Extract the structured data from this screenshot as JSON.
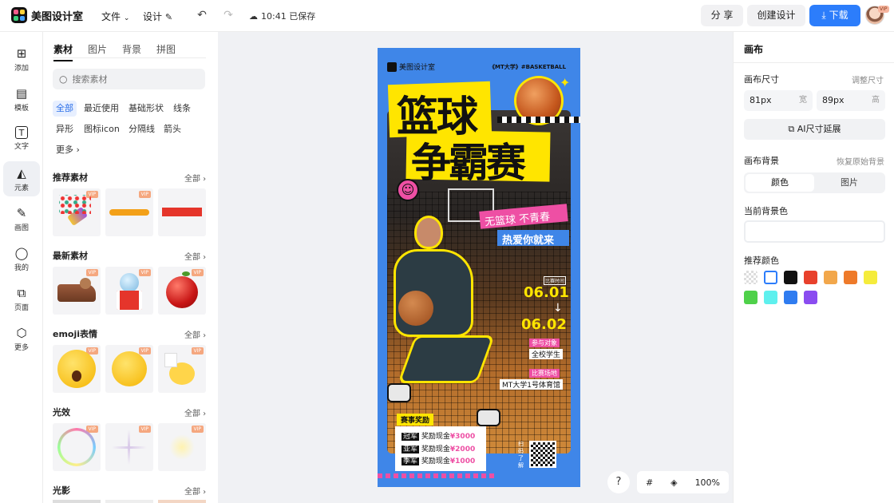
{
  "app": {
    "name": "美图设计室"
  },
  "topbar": {
    "file_menu": "文件",
    "design_menu": "设计",
    "save_status": "10:41 已保存",
    "share": "分 享",
    "create_design": "创建设计",
    "download": "下载",
    "avatar_badge": "VIP"
  },
  "leftnav": [
    {
      "label": "添加",
      "icon": "plus-square-icon"
    },
    {
      "label": "模板",
      "icon": "template-icon"
    },
    {
      "label": "文字",
      "icon": "text-icon"
    },
    {
      "label": "元素",
      "icon": "shapes-icon"
    },
    {
      "label": "画图",
      "icon": "draw-icon"
    },
    {
      "label": "我的",
      "icon": "user-icon"
    },
    {
      "label": "页面",
      "icon": "page-add-icon"
    },
    {
      "label": "更多",
      "icon": "cube-icon"
    }
  ],
  "panel": {
    "tabs": [
      "素材",
      "图片",
      "背景",
      "拼图"
    ],
    "active_tab": "素材",
    "search_placeholder": "搜索素材",
    "chips": [
      "全部",
      "最近使用",
      "基础形状",
      "线条",
      "异形",
      "图标icon",
      "分隔线",
      "箭头",
      "更多"
    ],
    "active_chip": "全部",
    "sections": [
      {
        "title": "推荐素材",
        "all": "全部"
      },
      {
        "title": "最新素材",
        "all": "全部"
      },
      {
        "title": "emoji表情",
        "all": "全部"
      },
      {
        "title": "光效",
        "all": "全部"
      },
      {
        "title": "光影",
        "all": "全部"
      }
    ],
    "vip_badge": "VIP"
  },
  "poster": {
    "brand": "美图设计室",
    "tag_line": "《MT大学》#BASKETBALL",
    "title_line1": "篮球",
    "title_line2": "争霸赛",
    "slogan1": "无篮球 不青春",
    "slogan2": "热爱你就来",
    "time_label": "比赛时间",
    "date_start": "06.01",
    "date_end": "06.02",
    "participants_label": "参与对象",
    "participants": "全校学生",
    "venue_label": "比赛场地",
    "venue": "MT大学1号体育馆",
    "awards_title": "赛事奖励",
    "awards": [
      {
        "rank": "冠军",
        "text": "奖励现金",
        "amount": "¥3000"
      },
      {
        "rank": "亚军",
        "text": "奖励现金",
        "amount": "¥2000"
      },
      {
        "rank": "季军",
        "text": "奖励现金",
        "amount": "¥1000"
      }
    ],
    "scan_text": "扫码了解"
  },
  "canvas_controls": {
    "help": "?",
    "zoom": "100%"
  },
  "right_panel": {
    "title": "画布",
    "size_label": "画布尺寸",
    "adjust_size": "调整尺寸",
    "width_value": "81px",
    "width_unit": "宽",
    "height_value": "89px",
    "height_unit": "高",
    "ai_extend": "AI尺寸延展",
    "bg_label": "画布背景",
    "restore_bg": "恢复原始背景",
    "seg_color": "颜色",
    "seg_image": "图片",
    "current_bg_label": "当前背景色",
    "recommended_label": "推荐颜色",
    "swatches": [
      "transparent",
      "#ffffff",
      "#111111",
      "#e8412c",
      "#f2a74b",
      "#ee7a2a",
      "#f5ec3c",
      "#4fd14a",
      "#5ef0ee",
      "#2f7cf0",
      "#8a4cf0"
    ]
  },
  "colors": {
    "accent": "#2c7dfb",
    "poster_blue": "#3f86e8",
    "poster_yellow": "#ffe500",
    "poster_pink": "#ee4fa4"
  }
}
